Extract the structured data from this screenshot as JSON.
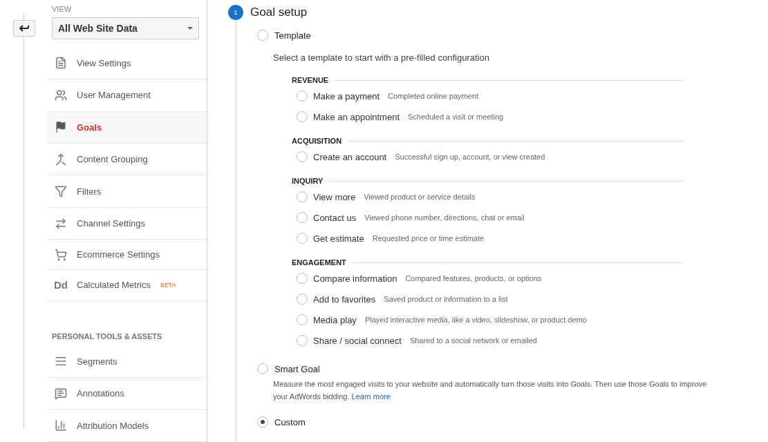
{
  "sidebar": {
    "view_label": "VIEW",
    "view_select": "All Web Site Data",
    "items": [
      {
        "label": "View Settings",
        "selected": false
      },
      {
        "label": "User Management",
        "selected": false
      },
      {
        "label": "Goals",
        "selected": true
      },
      {
        "label": "Content Grouping",
        "selected": false
      },
      {
        "label": "Filters",
        "selected": false
      },
      {
        "label": "Channel Settings",
        "selected": false
      },
      {
        "label": "Ecommerce Settings",
        "selected": false
      },
      {
        "label": "Calculated Metrics",
        "icon_text": "Dd",
        "badge": "BETA",
        "selected": false
      }
    ],
    "section_title": "PERSONAL TOOLS & ASSETS",
    "personal_items": [
      {
        "label": "Segments",
        "selected": false
      },
      {
        "label": "Annotations",
        "selected": false
      },
      {
        "label": "Attribution Models",
        "selected": false
      }
    ]
  },
  "step": {
    "number": "1",
    "title": "Goal setup"
  },
  "goal_types": [
    {
      "kind": "template",
      "label": "Template",
      "selected": false,
      "description": "Select a template to start with a pre-filled configuration",
      "groups": [
        {
          "title": "REVENUE",
          "options": [
            {
              "label": "Make a payment",
              "hint": "Completed online payment",
              "selected": false
            },
            {
              "label": "Make an appointment",
              "hint": "Scheduled a visit or meeting",
              "selected": false
            }
          ]
        },
        {
          "title": "ACQUISITION",
          "options": [
            {
              "label": "Create an account",
              "hint": "Successful sign up, account, or view created",
              "selected": false
            }
          ]
        },
        {
          "title": "INQUIRY",
          "options": [
            {
              "label": "View more",
              "hint": "Viewed product or service details",
              "selected": false
            },
            {
              "label": "Contact us",
              "hint": "Viewed phone number, directions, chat or email",
              "selected": false
            },
            {
              "label": "Get estimate",
              "hint": "Requested price or time estimate",
              "selected": false
            }
          ]
        },
        {
          "title": "ENGAGEMENT",
          "options": [
            {
              "label": "Compare information",
              "hint": "Compared features, products, or options",
              "selected": false
            },
            {
              "label": "Add to favorites",
              "hint": "Saved product or information to a list",
              "selected": false
            },
            {
              "label": "Media play",
              "hint": "Played interactive media, like a video, slideshow, or product demo",
              "selected": false
            },
            {
              "label": "Share / social connect",
              "hint": "Shared to a social network or emailed",
              "selected": false
            }
          ]
        }
      ]
    },
    {
      "kind": "smart",
      "label": "Smart Goal",
      "selected": false,
      "description": "Measure the most engaged visits to your website and automatically turn those visits into Goals. Then use those Goals to improve your AdWords bidding.",
      "link": "Learn more"
    },
    {
      "kind": "custom",
      "label": "Custom",
      "selected": true
    }
  ]
}
